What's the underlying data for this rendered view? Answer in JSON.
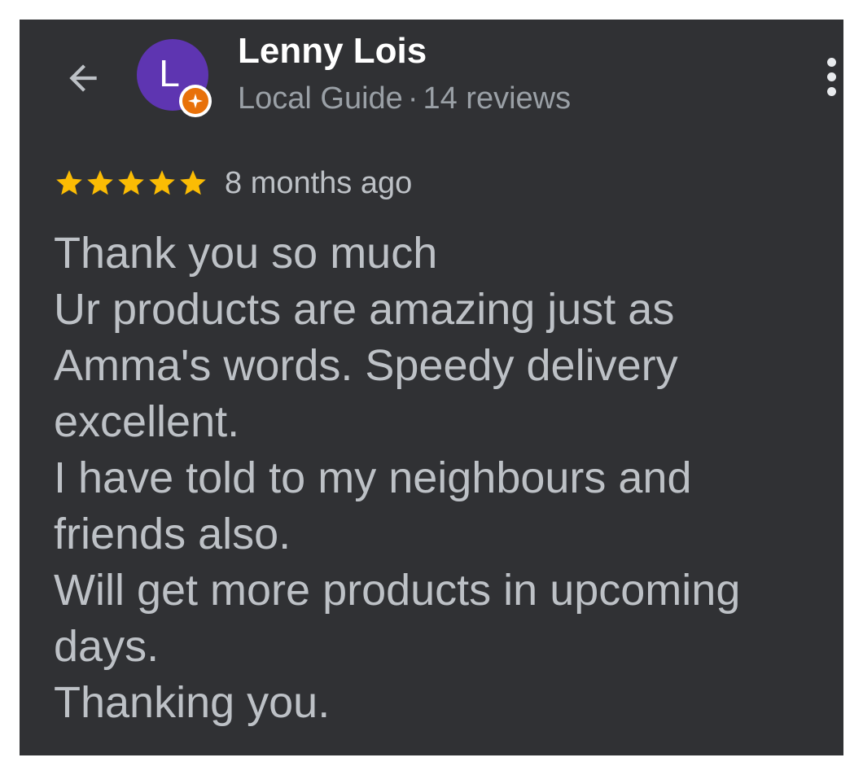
{
  "header": {
    "back_icon": "arrow-left-icon",
    "more_icon": "more-vertical-icon"
  },
  "reviewer": {
    "avatar_initial": "L",
    "avatar_color": "#5e35b1",
    "badge_icon": "local-guide-badge-icon",
    "badge_color": "#e8710a",
    "name": "Lenny Lois",
    "title": "Local Guide",
    "separator": "·",
    "review_count": "14 reviews"
  },
  "review": {
    "rating": 5,
    "max_rating": 5,
    "star_color": "#fbbc04",
    "date": "8 months ago",
    "lines": [
      "Thank you so much",
      "Ur products are amazing just as",
      "Amma's words. Speedy delivery",
      "excellent.",
      "I have told to my neighbours and",
      "friends also.",
      "Will get more products in upcoming",
      "days.",
      "Thanking you."
    ]
  },
  "colors": {
    "background": "#303134",
    "name_text": "#ffffff",
    "meta_text": "#9aa0a6",
    "body_text": "#bdc1c6"
  }
}
